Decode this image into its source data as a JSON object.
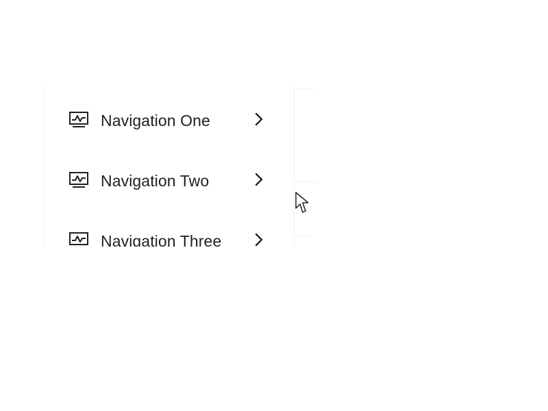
{
  "menu": {
    "items": [
      {
        "label": "Navigation One",
        "icon": "monitor-chart-icon",
        "arrow": "chevron-right-icon"
      },
      {
        "label": "Navigation Two",
        "icon": "monitor-chart-icon",
        "arrow": "chevron-right-icon"
      },
      {
        "label": "Navigation Three",
        "icon": "monitor-chart-icon",
        "arrow": "chevron-right-icon"
      }
    ]
  },
  "colors": {
    "text": "#1f1f1f",
    "background": "#ffffff",
    "border": "#ececec"
  }
}
